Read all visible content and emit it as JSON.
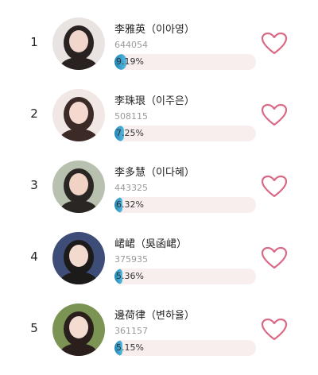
{
  "ranking": [
    {
      "rank": "1",
      "name": "李雅英（이아영）",
      "votes": "644054",
      "percent_text": "9.19%",
      "percent": 9.19,
      "icon": "heart-outline-icon",
      "avatar_colors": [
        "#e9e4e2",
        "#2a2220",
        "#f0d6cc"
      ]
    },
    {
      "rank": "2",
      "name": "李珠珢（이주은）",
      "votes": "508115",
      "percent_text": "7.25%",
      "percent": 7.25,
      "icon": "heart-outline-icon",
      "avatar_colors": [
        "#f1e7e4",
        "#3b2a26",
        "#f5d9cf"
      ]
    },
    {
      "rank": "3",
      "name": "李多慧（이다혜）",
      "votes": "443325",
      "percent_text": "6.32%",
      "percent": 6.32,
      "icon": "heart-outline-icon",
      "avatar_colors": [
        "#b8c0b0",
        "#2a2624",
        "#f1d3c6"
      ]
    },
    {
      "rank": "4",
      "name": "峮峮（吳函峮）",
      "votes": "375935",
      "percent_text": "5.36%",
      "percent": 5.36,
      "icon": "heart-outline-icon",
      "avatar_colors": [
        "#3e4c78",
        "#1d1a1a",
        "#f3dacf"
      ]
    },
    {
      "rank": "5",
      "name": "邊荷律（변하율）",
      "votes": "361157",
      "percent_text": "5.15%",
      "percent": 5.15,
      "icon": "heart-outline-icon",
      "avatar_colors": [
        "#7b9454",
        "#2a1f1c",
        "#f4dcd1"
      ]
    }
  ],
  "colors": {
    "heart": "#d96a86",
    "bar_track": "#f8eeee",
    "bar_fill": "#1c86b7",
    "votes_text": "#9a9a9a"
  }
}
